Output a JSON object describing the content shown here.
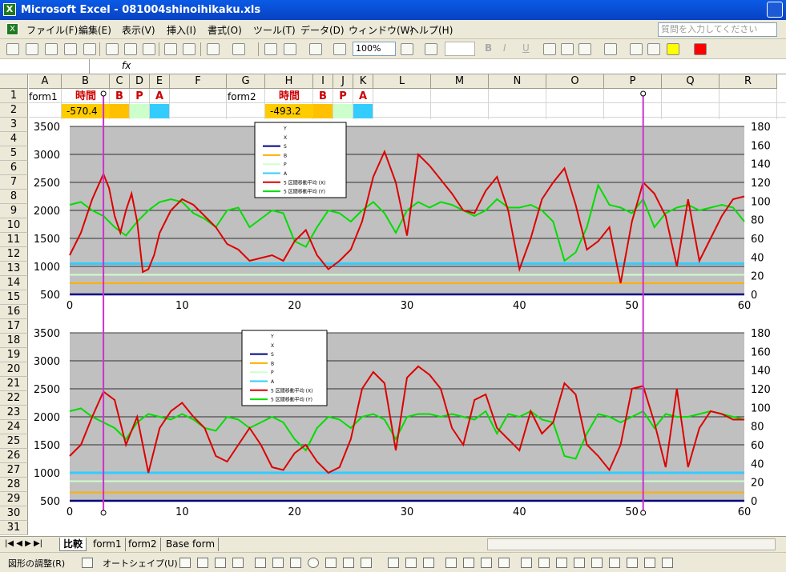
{
  "window": {
    "title": "Microsoft Excel - 081004shinoihikaku.xls"
  },
  "menu": {
    "items": [
      "ファイル(F)",
      "編集(E)",
      "表示(V)",
      "挿入(I)",
      "書式(O)",
      "ツール(T)",
      "データ(D)",
      "ウィンドウ(W)",
      "ヘルプ(H)"
    ],
    "help_placeholder": "質問を入力してください"
  },
  "toolbar": {
    "zoom": "100%",
    "bold": "B",
    "italic": "I",
    "underline": "U"
  },
  "formula_bar": {
    "fx": "fx",
    "name_box": ""
  },
  "columns": [
    "A",
    "B",
    "C",
    "D",
    "E",
    "F",
    "G",
    "H",
    "I",
    "J",
    "K",
    "L",
    "M",
    "N",
    "O",
    "P",
    "Q",
    "R"
  ],
  "rows": [
    "1",
    "2",
    "3",
    "4",
    "5",
    "6",
    "7",
    "8",
    "9",
    "10",
    "11",
    "12",
    "13",
    "14",
    "15",
    "16",
    "17",
    "18",
    "19",
    "20",
    "21",
    "22",
    "23",
    "24",
    "25",
    "26",
    "27",
    "28",
    "29",
    "30",
    "31"
  ],
  "cells": {
    "a1": "form1",
    "b1": "時間",
    "c1": "B",
    "d1": "P",
    "e1": "A",
    "b2": "-570.4",
    "g1": "form2",
    "h1": "時間",
    "i1": "B",
    "j1": "P",
    "k1": "A",
    "h2": "-493.2"
  },
  "colors": {
    "red_label": "#cc0000",
    "yellow_fill": "#ffcc00",
    "orange_fill": "#ffc000",
    "green_fill": "#ccffcc",
    "cyan_fill": "#33ccff",
    "plot_bg": "#c0c0c0",
    "magenta": "#cc33cc"
  },
  "chart_data": [
    {
      "type": "line",
      "x_ticks": [
        "0",
        "10",
        "20",
        "30",
        "40",
        "50",
        "60"
      ],
      "y_ticks": [
        "500",
        "1000",
        "1500",
        "2000",
        "2500",
        "3000",
        "3500"
      ],
      "y2_ticks": [
        "0",
        "20",
        "40",
        "60",
        "80",
        "100",
        "120",
        "140",
        "160",
        "180"
      ],
      "ylim": [
        500,
        3500
      ],
      "y2lim": [
        0,
        180
      ],
      "xlim": [
        0,
        60
      ],
      "legend_position": "top-center",
      "legend": [
        "Y",
        "X",
        "S",
        "B",
        "P",
        "A",
        "5 区間移動平均 (X)",
        "5 区間移動平均 (Y)"
      ],
      "series": [
        {
          "name": "5 区間移動平均 (X)",
          "color": "#dd0000",
          "x": [
            0,
            1,
            2,
            3,
            3.5,
            4,
            4.5,
            5,
            5.5,
            6,
            6.5,
            7,
            7.5,
            8,
            9,
            10,
            11,
            12,
            13,
            14,
            15,
            16,
            17,
            18,
            19,
            20,
            21,
            22,
            23,
            24,
            25,
            26,
            27,
            28,
            29,
            30,
            31,
            32,
            33,
            34,
            35,
            36,
            37,
            38,
            39,
            40,
            41,
            42,
            43,
            44,
            45,
            46,
            47,
            48,
            49,
            50,
            51,
            52,
            53,
            54,
            55,
            56,
            57,
            58,
            59,
            60
          ],
          "y": [
            1200,
            1600,
            2200,
            2650,
            2400,
            1900,
            1600,
            2000,
            2300,
            1800,
            900,
            950,
            1200,
            1600,
            2000,
            2200,
            2100,
            1900,
            1700,
            1400,
            1300,
            1100,
            1150,
            1200,
            1100,
            1450,
            1650,
            1200,
            950,
            1100,
            1300,
            1800,
            2600,
            3050,
            2500,
            1550,
            3000,
            2800,
            2550,
            2300,
            2000,
            1950,
            2350,
            2600,
            2000,
            950,
            1500,
            2200,
            2500,
            2750,
            2100,
            1300,
            1450,
            1700,
            700,
            1800,
            2500,
            2300,
            1900,
            1000,
            2200,
            1100,
            1500,
            1900,
            2200,
            2250
          ]
        },
        {
          "name": "5 区間移動平均 (Y)",
          "color": "#00dd00",
          "x": [
            0,
            1,
            2,
            3,
            4,
            5,
            6,
            7,
            8,
            9,
            10,
            11,
            12,
            13,
            14,
            15,
            16,
            17,
            18,
            19,
            20,
            21,
            22,
            23,
            24,
            25,
            26,
            27,
            28,
            29,
            30,
            31,
            32,
            33,
            34,
            35,
            36,
            37,
            38,
            39,
            40,
            41,
            42,
            43,
            44,
            45,
            46,
            47,
            48,
            49,
            50,
            51,
            52,
            53,
            54,
            55,
            56,
            57,
            58,
            59,
            60
          ],
          "y": [
            2100,
            2150,
            2000,
            1900,
            1700,
            1550,
            1800,
            2000,
            2150,
            2200,
            2150,
            1950,
            1850,
            1700,
            2000,
            2050,
            1700,
            1850,
            2000,
            1950,
            1450,
            1350,
            1700,
            2000,
            1950,
            1800,
            2000,
            2150,
            1950,
            1600,
            2000,
            2150,
            2050,
            2150,
            2100,
            2000,
            1900,
            2000,
            2200,
            2050,
            2050,
            2100,
            2000,
            1800,
            1100,
            1250,
            1700,
            2450,
            2100,
            2050,
            1950,
            2200,
            1700,
            1950,
            2050,
            2100,
            2000,
            2050,
            2100,
            2050,
            1800
          ]
        },
        {
          "name": "A",
          "color": "#33ccff",
          "x": [
            0,
            60
          ],
          "y": [
            1050,
            1050
          ]
        },
        {
          "name": "P",
          "color": "#ccffcc",
          "x": [
            0,
            60
          ],
          "y": [
            850,
            850
          ]
        },
        {
          "name": "B",
          "color": "#ffb000",
          "x": [
            0,
            60
          ],
          "y": [
            700,
            700
          ]
        },
        {
          "name": "S",
          "color": "#000080",
          "x": [
            0,
            60
          ],
          "y": [
            500,
            500
          ]
        }
      ]
    },
    {
      "type": "line",
      "x_ticks": [
        "0",
        "10",
        "20",
        "30",
        "40",
        "50",
        "60"
      ],
      "y_ticks": [
        "500",
        "1000",
        "1500",
        "2000",
        "2500",
        "3000",
        "3500"
      ],
      "y2_ticks": [
        "0",
        "20",
        "40",
        "60",
        "80",
        "100",
        "120",
        "140",
        "160",
        "180"
      ],
      "ylim": [
        500,
        3500
      ],
      "y2lim": [
        0,
        180
      ],
      "xlim": [
        0,
        60
      ],
      "legend_position": "top-center",
      "legend": [
        "Y",
        "X",
        "S",
        "B",
        "P",
        "A",
        "5 区間移動平均 (X)",
        "5 区間移動平均 (Y)"
      ],
      "series": [
        {
          "name": "5 区間移動平均 (X)",
          "color": "#dd0000",
          "x": [
            0,
            1,
            2,
            3,
            4,
            5,
            6,
            7,
            8,
            9,
            10,
            11,
            12,
            13,
            14,
            15,
            16,
            17,
            18,
            19,
            20,
            21,
            22,
            23,
            24,
            25,
            26,
            27,
            28,
            29,
            30,
            31,
            32,
            33,
            34,
            35,
            36,
            37,
            38,
            39,
            40,
            41,
            42,
            43,
            44,
            45,
            46,
            47,
            48,
            49,
            50,
            51,
            52,
            53,
            54,
            55,
            56,
            57,
            58,
            59,
            60
          ],
          "y": [
            1300,
            1500,
            2000,
            2450,
            2300,
            1500,
            2000,
            1000,
            1800,
            2100,
            2250,
            2000,
            1800,
            1300,
            1200,
            1500,
            1800,
            1500,
            1100,
            1050,
            1350,
            1500,
            1200,
            1000,
            1100,
            1600,
            2500,
            2800,
            2600,
            1400,
            2700,
            2900,
            2750,
            2500,
            1800,
            1500,
            2300,
            2400,
            1800,
            1600,
            1400,
            2100,
            1700,
            1900,
            2600,
            2400,
            1500,
            1300,
            1050,
            1500,
            2500,
            2550,
            1900,
            1100,
            2500,
            1100,
            1800,
            2100,
            2050,
            1950,
            1950
          ]
        },
        {
          "name": "5 区間移動平均 (Y)",
          "color": "#00dd00",
          "x": [
            0,
            1,
            2,
            3,
            4,
            5,
            6,
            7,
            8,
            9,
            10,
            11,
            12,
            13,
            14,
            15,
            16,
            17,
            18,
            19,
            20,
            21,
            22,
            23,
            24,
            25,
            26,
            27,
            28,
            29,
            30,
            31,
            32,
            33,
            34,
            35,
            36,
            37,
            38,
            39,
            40,
            41,
            42,
            43,
            44,
            45,
            46,
            47,
            48,
            49,
            50,
            51,
            52,
            53,
            54,
            55,
            56,
            57,
            58,
            59,
            60
          ],
          "y": [
            2100,
            2150,
            2000,
            1900,
            1800,
            1600,
            1900,
            2050,
            2000,
            1950,
            2050,
            1950,
            1800,
            1750,
            2000,
            1950,
            1800,
            1900,
            2000,
            1900,
            1600,
            1400,
            1800,
            2000,
            1950,
            1800,
            2000,
            2050,
            1950,
            1600,
            2000,
            2050,
            2050,
            2000,
            2050,
            2000,
            1950,
            2100,
            1700,
            2050,
            2000,
            2100,
            1950,
            1900,
            1300,
            1250,
            1700,
            2050,
            2000,
            1900,
            2000,
            2100,
            1800,
            2050,
            2000,
            2000,
            2050,
            2100,
            2050,
            2000,
            1950
          ]
        },
        {
          "name": "A",
          "color": "#33ccff",
          "x": [
            0,
            60
          ],
          "y": [
            1000,
            1000
          ]
        },
        {
          "name": "P",
          "color": "#ccffcc",
          "x": [
            0,
            60
          ],
          "y": [
            850,
            850
          ]
        },
        {
          "name": "B",
          "color": "#ffb000",
          "x": [
            0,
            60
          ],
          "y": [
            650,
            650
          ]
        },
        {
          "name": "S",
          "color": "#000080",
          "x": [
            0,
            60
          ],
          "y": [
            500,
            500
          ]
        }
      ]
    }
  ],
  "markers": {
    "x_values": [
      3,
      51
    ]
  },
  "sheets": {
    "tabs": [
      "比較",
      "form1",
      "form2",
      "Base form"
    ]
  },
  "drawing": {
    "adjust": "図形の調整(R)",
    "autoshapes": "オートシェイプ(U)"
  }
}
